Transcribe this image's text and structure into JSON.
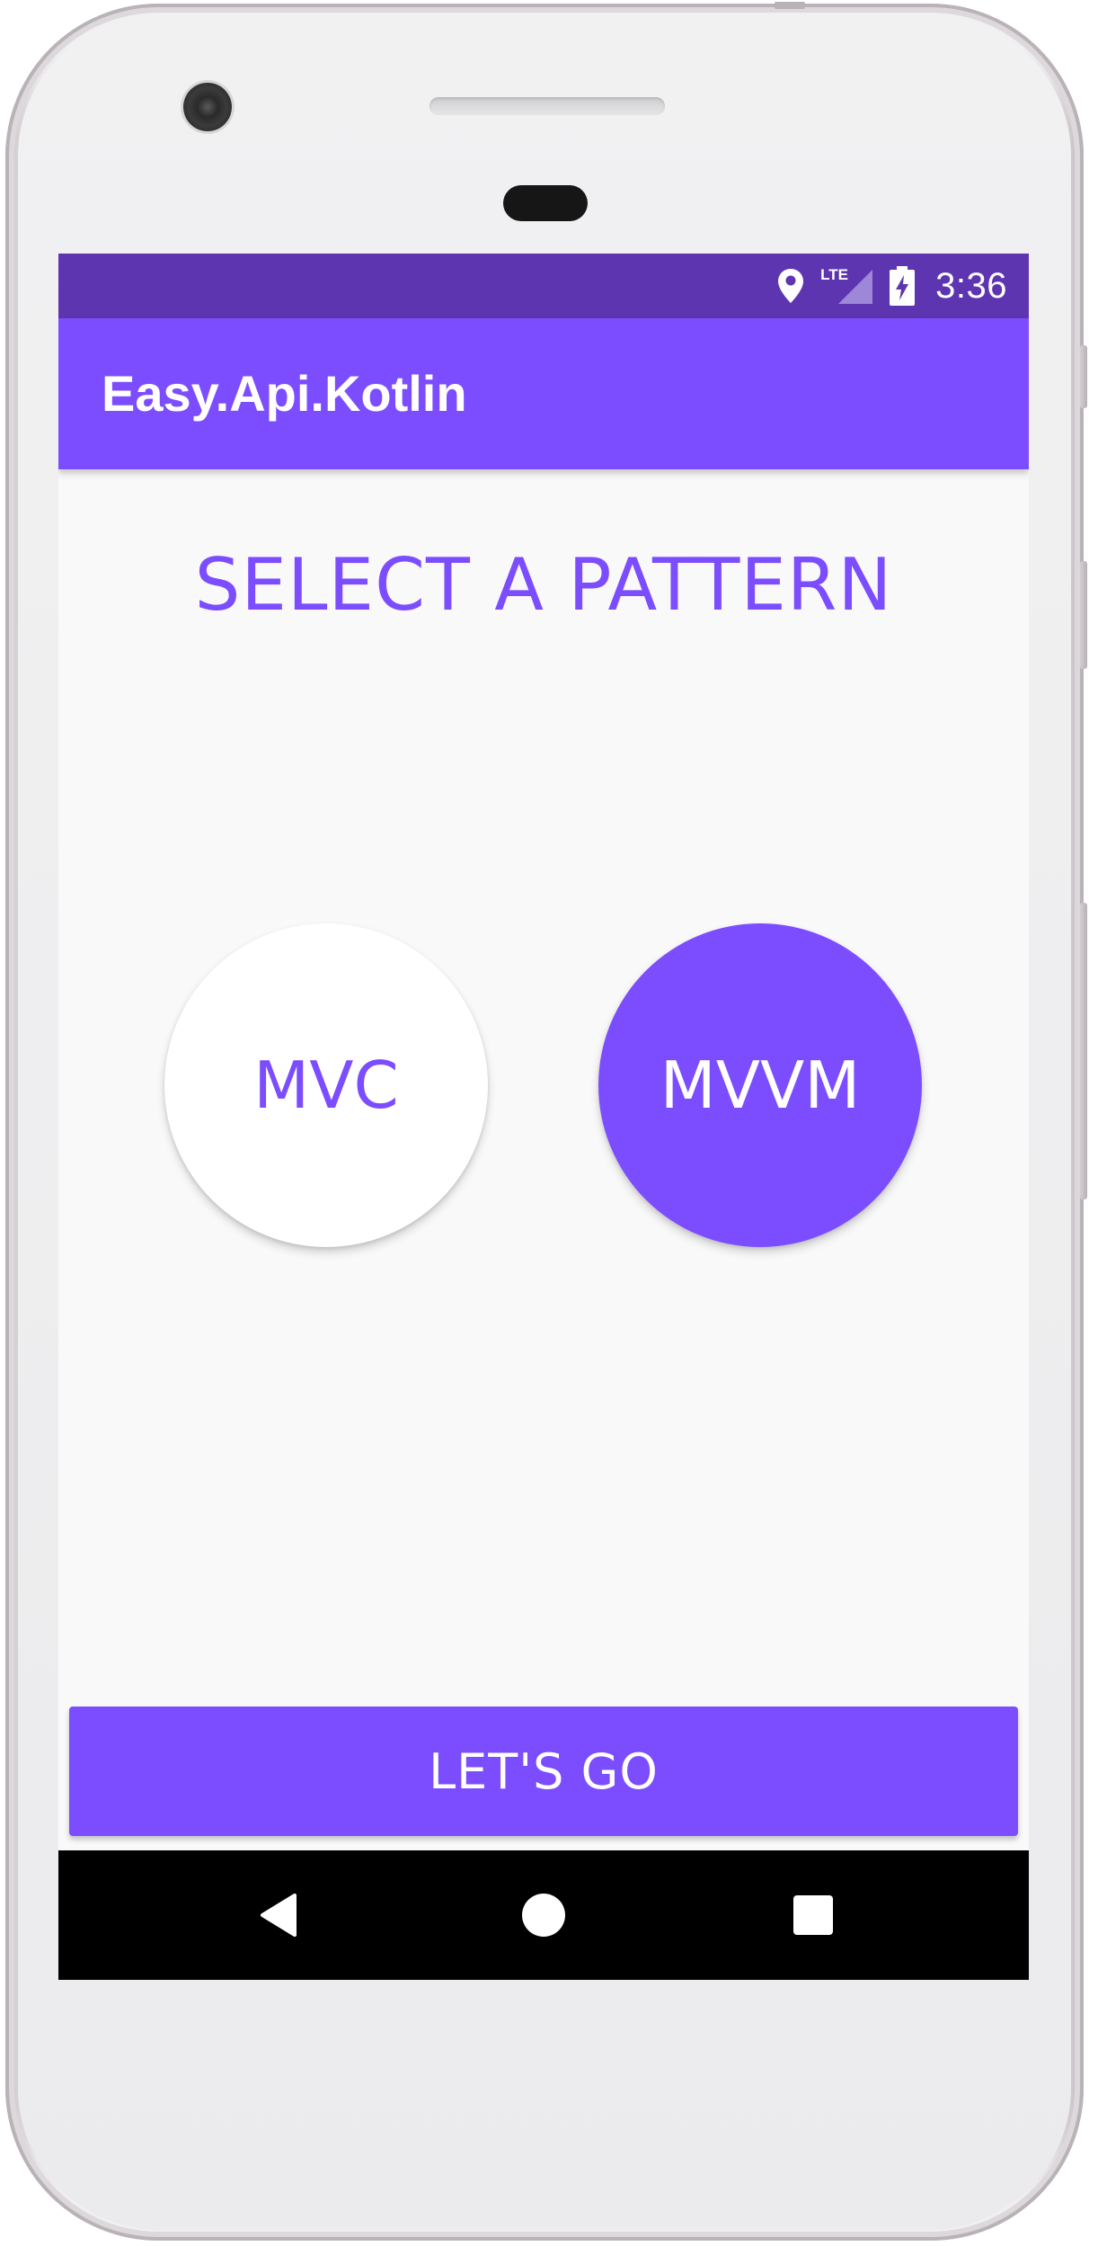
{
  "status_bar": {
    "time": "3:36",
    "network": "LTE",
    "icons": [
      "location-icon",
      "lte-signal-icon",
      "battery-charging-icon"
    ]
  },
  "app_bar": {
    "title": "Easy.Api.Kotlin"
  },
  "main": {
    "heading": "SELECT A PATTERN",
    "options": [
      {
        "label": "MVC",
        "selected": false
      },
      {
        "label": "MVVM",
        "selected": true
      }
    ],
    "submit_label": "LET'S GO"
  },
  "nav_bar": {
    "buttons": [
      "back-icon",
      "home-icon",
      "recents-icon"
    ]
  },
  "colors": {
    "status_bar": "#5e35b1",
    "primary": "#7c4dff",
    "background": "#f9f9fa",
    "nav_bar": "#000000"
  }
}
